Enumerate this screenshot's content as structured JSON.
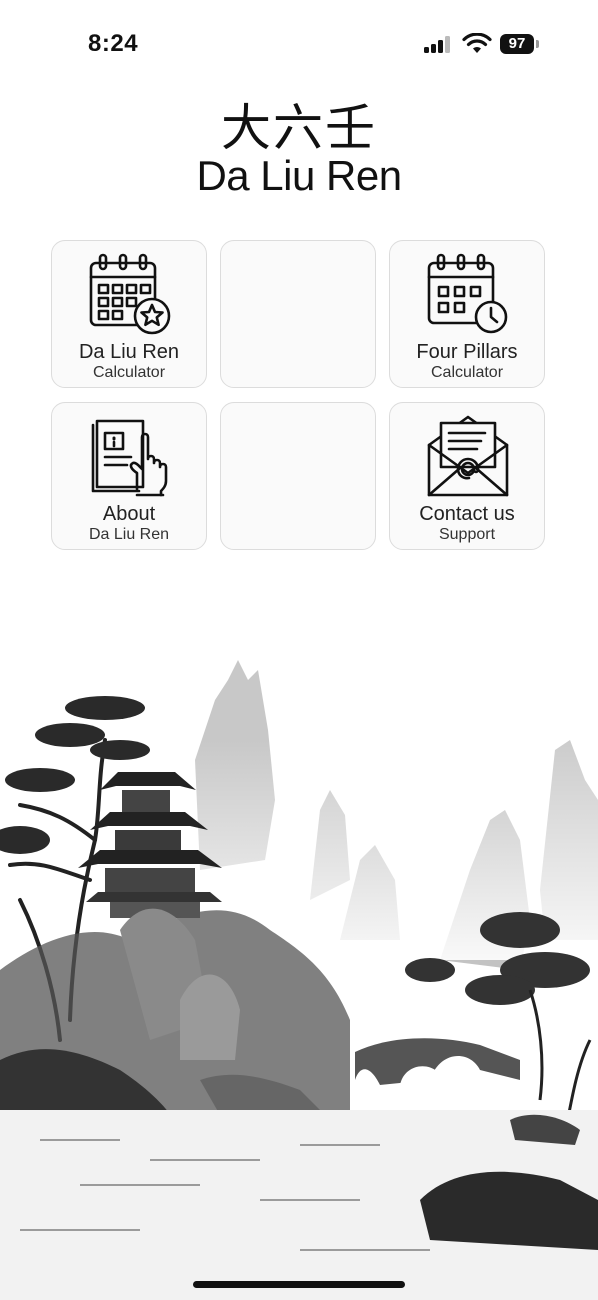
{
  "status_bar": {
    "time": "8:24",
    "battery": "97"
  },
  "header": {
    "title_cn": "大六壬",
    "title_en": "Da Liu Ren"
  },
  "tiles": [
    {
      "title": "Da Liu Ren",
      "subtitle": "Calculator",
      "icon": "calendar-star-icon"
    },
    {
      "title": "",
      "subtitle": "",
      "icon": ""
    },
    {
      "title": "Four Pillars",
      "subtitle": "Calculator",
      "icon": "calendar-clock-icon"
    },
    {
      "title": "About",
      "subtitle": "Da Liu Ren",
      "icon": "info-book-icon"
    },
    {
      "title": "",
      "subtitle": "",
      "icon": ""
    },
    {
      "title": "Contact us",
      "subtitle": "Support",
      "icon": "mail-envelope-icon"
    }
  ],
  "colors": {
    "background": "#ffffff",
    "tile_background": "#fafafa",
    "tile_border": "#dcdcdc",
    "text": "#111111"
  }
}
